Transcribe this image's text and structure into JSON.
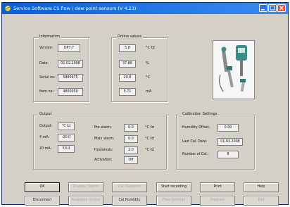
{
  "title": "Service Software CS flow / dew point sensors (V 4.23)",
  "information": {
    "legend": "Information",
    "version_label": "Version:",
    "version": "DP7.7",
    "date_label": "Date:",
    "date": "01.02.2008",
    "serial_label": "Serial no.:",
    "serial": "5880975",
    "item_label": "Item no.:",
    "item": "4800050"
  },
  "online": {
    "legend": "Online values",
    "v1": "5.8",
    "u1": "°C td",
    "v2": "37.86",
    "u2": "%",
    "v3": "20.8",
    "u3": "°C",
    "v4": "5.71",
    "u4": "mA"
  },
  "output": {
    "legend": "Output",
    "output_label": "Output:",
    "output_value": "°C td",
    "ma4_label": "4 mA:",
    "ma4": "-20.0",
    "ma20_label": "20 mA:",
    "ma20": "50.0",
    "prealarm_label": "Pre alarm:",
    "prealarm": "0.0",
    "prealarm_unit": "°C td",
    "mainalarm_label": "Main alarm:",
    "mainalarm": "0.0",
    "mainalarm_unit": "°C td",
    "hysteresis_label": "Hysteresis:",
    "hysteresis": "2.0",
    "hysteresis_unit": "°C td",
    "activation_label": "Activation:",
    "activation": "Off"
  },
  "calibration": {
    "legend": "Calibration Settings",
    "humidity_label": "Humidity Offset:",
    "humidity": "0.00",
    "lastcal_label": "Last Cal. Date:",
    "lastcal": "01.02.2008",
    "numcal_label": "Number of Cal.:",
    "numcal": "8"
  },
  "buttons": {
    "r1": [
      "OK",
      "Display / Alarm",
      "Cal Dewpoint",
      "Start recording",
      "Print",
      "Help"
    ],
    "r2": [
      "Disconnect",
      "Analogue Output",
      "Cal Humidity",
      "Flow Settings",
      "Program",
      "Exit"
    ]
  },
  "colors": {
    "titlebar": "#0a5fd8",
    "face": "#d4d0c8",
    "close": "#e0503a"
  }
}
